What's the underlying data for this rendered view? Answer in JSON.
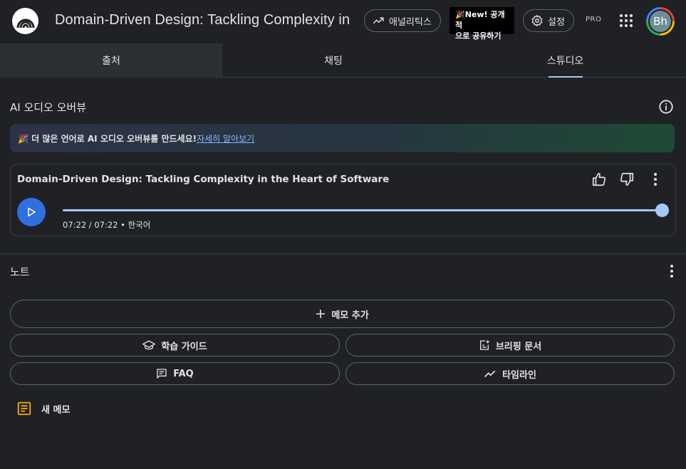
{
  "header": {
    "title": "Domain-Driven Design: Tackling Complexity in",
    "analytics_label": "애널리틱스",
    "share_label_line1": "🎉New! 공개적",
    "share_label_line2": "으로 공유하기",
    "settings_label": "설정",
    "pro_label": "PRO",
    "avatar_initials": "Bh"
  },
  "tabs": [
    {
      "label": "출처"
    },
    {
      "label": "채팅"
    },
    {
      "label": "스튜디오"
    }
  ],
  "audio_overview": {
    "section_title": "AI 오디오 오버뷰",
    "banner_text": "🎉 더 많은 언어로 AI 오디오 오버뷰를 만드세요!",
    "banner_link": "자세히 알아보기",
    "player_title": "Domain-Driven Design: Tackling Complexity in the Heart of Software",
    "time_text": "07:22 / 07:22 • 한국어",
    "progress_fraction": 1.0
  },
  "notes": {
    "section_title": "노트",
    "add_note_label": "메모 추가",
    "study_guide_label": "학습 가이드",
    "briefing_label": "브리핑 문서",
    "faq_label": "FAQ",
    "timeline_label": "타임라인",
    "new_memo_label": "새 메모"
  },
  "colors": {
    "background": "#1f2124",
    "accent": "#a8c7fa",
    "play_button": "#2f6fe0",
    "memo_icon": "#f9ab00"
  }
}
